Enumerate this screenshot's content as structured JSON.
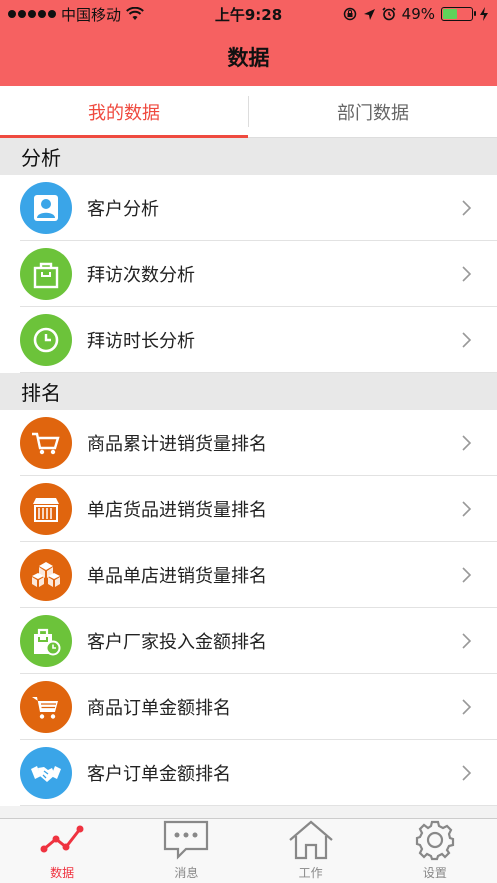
{
  "status_bar": {
    "carrier": "中国移动",
    "time": "上午9:28",
    "battery_percent": "49%",
    "battery_level": 0.49
  },
  "header": {
    "title": "数据"
  },
  "tabs": [
    {
      "label": "我的数据",
      "active": true
    },
    {
      "label": "部门数据",
      "active": false
    }
  ],
  "sections": [
    {
      "title": "分析",
      "items": [
        {
          "label": "客户分析",
          "icon": "person-icon",
          "color": "#3aa5e8"
        },
        {
          "label": "拜访次数分析",
          "icon": "bag-icon",
          "color": "#6cc33a"
        },
        {
          "label": "拜访时长分析",
          "icon": "clock-icon",
          "color": "#6cc33a"
        }
      ]
    },
    {
      "title": "排名",
      "items": [
        {
          "label": "商品累计进销货量排名",
          "icon": "cart-icon",
          "color": "#e0650e"
        },
        {
          "label": "单店货品进销货量排名",
          "icon": "store-icon",
          "color": "#e0650e"
        },
        {
          "label": "单品单店进销货量排名",
          "icon": "boxes-icon",
          "color": "#e0650e"
        },
        {
          "label": "客户厂家投入金额排名",
          "icon": "shopping-bag-clock-icon",
          "color": "#6cc33a"
        },
        {
          "label": "商品订单金额排名",
          "icon": "basket-icon",
          "color": "#e0650e"
        },
        {
          "label": "客户订单金额排名",
          "icon": "handshake-icon",
          "color": "#3aa5e8"
        }
      ]
    }
  ],
  "tab_bar": [
    {
      "label": "数据",
      "icon": "chart-line-icon",
      "active": true
    },
    {
      "label": "消息",
      "icon": "chat-bubble-icon",
      "active": false
    },
    {
      "label": "工作",
      "icon": "home-icon",
      "active": false
    },
    {
      "label": "设置",
      "icon": "gear-icon",
      "active": false
    }
  ],
  "colors": {
    "header": "#f66161",
    "accent": "#ef4a3f",
    "blue": "#3aa5e8",
    "green": "#6cc33a",
    "orange": "#e0650e"
  }
}
